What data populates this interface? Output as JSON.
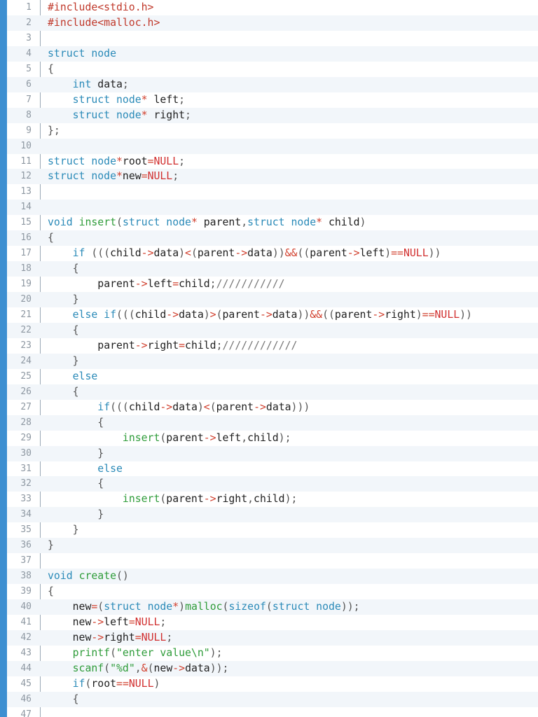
{
  "colors": {
    "accent_bar": "#3d8fd1",
    "keyword": "#2a8ab8",
    "function": "#2f9c3a",
    "operator": "#d1402e",
    "null": "#d12f2f",
    "preprocessor": "#c0392b",
    "string": "#2f9c3a",
    "identifier": "#1f1f1f",
    "line_number": "#8e98a2",
    "alt_row_bg": "#f2f6fa"
  },
  "lines": [
    {
      "n": "1",
      "tokens": [
        {
          "t": "#include<stdio.h>",
          "c": "pp"
        }
      ]
    },
    {
      "n": "2",
      "tokens": [
        {
          "t": "#include<malloc.h>",
          "c": "pp"
        }
      ]
    },
    {
      "n": "3",
      "tokens": []
    },
    {
      "n": "4",
      "tokens": [
        {
          "t": "struct node",
          "c": "kw"
        }
      ]
    },
    {
      "n": "5",
      "tokens": [
        {
          "t": "{",
          "c": "pu"
        }
      ]
    },
    {
      "n": "6",
      "tokens": [
        {
          "t": "    ",
          "c": "id"
        },
        {
          "t": "int",
          "c": "kw"
        },
        {
          "t": " data",
          "c": "id"
        },
        {
          "t": ";",
          "c": "pu"
        }
      ]
    },
    {
      "n": "7",
      "tokens": [
        {
          "t": "    ",
          "c": "id"
        },
        {
          "t": "struct node",
          "c": "kw"
        },
        {
          "t": "*",
          "c": "op"
        },
        {
          "t": " left",
          "c": "id"
        },
        {
          "t": ";",
          "c": "pu"
        }
      ]
    },
    {
      "n": "8",
      "tokens": [
        {
          "t": "    ",
          "c": "id"
        },
        {
          "t": "struct node",
          "c": "kw"
        },
        {
          "t": "*",
          "c": "op"
        },
        {
          "t": " right",
          "c": "id"
        },
        {
          "t": ";",
          "c": "pu"
        }
      ]
    },
    {
      "n": "9",
      "tokens": [
        {
          "t": "};",
          "c": "pu"
        }
      ]
    },
    {
      "n": "10",
      "tokens": []
    },
    {
      "n": "11",
      "tokens": [
        {
          "t": "struct node",
          "c": "kw"
        },
        {
          "t": "*",
          "c": "op"
        },
        {
          "t": "root",
          "c": "id"
        },
        {
          "t": "=",
          "c": "op"
        },
        {
          "t": "NULL",
          "c": "nu"
        },
        {
          "t": ";",
          "c": "pu"
        }
      ]
    },
    {
      "n": "12",
      "tokens": [
        {
          "t": "struct node",
          "c": "kw"
        },
        {
          "t": "*",
          "c": "op"
        },
        {
          "t": "new",
          "c": "id"
        },
        {
          "t": "=",
          "c": "op"
        },
        {
          "t": "NULL",
          "c": "nu"
        },
        {
          "t": ";",
          "c": "pu"
        }
      ]
    },
    {
      "n": "13",
      "tokens": []
    },
    {
      "n": "14",
      "tokens": []
    },
    {
      "n": "15",
      "tokens": [
        {
          "t": "void",
          "c": "kw"
        },
        {
          "t": " ",
          "c": "id"
        },
        {
          "t": "insert",
          "c": "fn"
        },
        {
          "t": "(",
          "c": "pu"
        },
        {
          "t": "struct node",
          "c": "kw"
        },
        {
          "t": "*",
          "c": "op"
        },
        {
          "t": " parent",
          "c": "id"
        },
        {
          "t": ",",
          "c": "pu"
        },
        {
          "t": "struct node",
          "c": "kw"
        },
        {
          "t": "*",
          "c": "op"
        },
        {
          "t": " child",
          "c": "id"
        },
        {
          "t": ")",
          "c": "pu"
        }
      ]
    },
    {
      "n": "16",
      "tokens": [
        {
          "t": "{",
          "c": "pu"
        }
      ]
    },
    {
      "n": "17",
      "tokens": [
        {
          "t": "    ",
          "c": "id"
        },
        {
          "t": "if",
          "c": "kw"
        },
        {
          "t": " (((",
          "c": "pu"
        },
        {
          "t": "child",
          "c": "id"
        },
        {
          "t": "->",
          "c": "op"
        },
        {
          "t": "data",
          "c": "id"
        },
        {
          "t": ")",
          "c": "pu"
        },
        {
          "t": "<",
          "c": "op"
        },
        {
          "t": "(",
          "c": "pu"
        },
        {
          "t": "parent",
          "c": "id"
        },
        {
          "t": "->",
          "c": "op"
        },
        {
          "t": "data",
          "c": "id"
        },
        {
          "t": "))",
          "c": "pu"
        },
        {
          "t": "&&",
          "c": "op"
        },
        {
          "t": "((",
          "c": "pu"
        },
        {
          "t": "parent",
          "c": "id"
        },
        {
          "t": "->",
          "c": "op"
        },
        {
          "t": "left",
          "c": "id"
        },
        {
          "t": ")",
          "c": "pu"
        },
        {
          "t": "==",
          "c": "op"
        },
        {
          "t": "NULL",
          "c": "nu"
        },
        {
          "t": "))",
          "c": "pu"
        }
      ]
    },
    {
      "n": "18",
      "tokens": [
        {
          "t": "    {",
          "c": "pu"
        }
      ]
    },
    {
      "n": "19",
      "tokens": [
        {
          "t": "        ",
          "c": "id"
        },
        {
          "t": "parent",
          "c": "id"
        },
        {
          "t": "->",
          "c": "op"
        },
        {
          "t": "left",
          "c": "id"
        },
        {
          "t": "=",
          "c": "op"
        },
        {
          "t": "child",
          "c": "id"
        },
        {
          "t": ";",
          "c": "pu"
        },
        {
          "t": "///////////",
          "c": "cm"
        }
      ]
    },
    {
      "n": "20",
      "tokens": [
        {
          "t": "    }",
          "c": "pu"
        }
      ]
    },
    {
      "n": "21",
      "tokens": [
        {
          "t": "    ",
          "c": "id"
        },
        {
          "t": "else if",
          "c": "kw"
        },
        {
          "t": "(((",
          "c": "pu"
        },
        {
          "t": "child",
          "c": "id"
        },
        {
          "t": "->",
          "c": "op"
        },
        {
          "t": "data",
          "c": "id"
        },
        {
          "t": ")",
          "c": "pu"
        },
        {
          "t": ">",
          "c": "op"
        },
        {
          "t": "(",
          "c": "pu"
        },
        {
          "t": "parent",
          "c": "id"
        },
        {
          "t": "->",
          "c": "op"
        },
        {
          "t": "data",
          "c": "id"
        },
        {
          "t": "))",
          "c": "pu"
        },
        {
          "t": "&&",
          "c": "op"
        },
        {
          "t": "((",
          "c": "pu"
        },
        {
          "t": "parent",
          "c": "id"
        },
        {
          "t": "->",
          "c": "op"
        },
        {
          "t": "right",
          "c": "id"
        },
        {
          "t": ")",
          "c": "pu"
        },
        {
          "t": "==",
          "c": "op"
        },
        {
          "t": "NULL",
          "c": "nu"
        },
        {
          "t": "))",
          "c": "pu"
        }
      ]
    },
    {
      "n": "22",
      "tokens": [
        {
          "t": "    {",
          "c": "pu"
        }
      ]
    },
    {
      "n": "23",
      "tokens": [
        {
          "t": "        ",
          "c": "id"
        },
        {
          "t": "parent",
          "c": "id"
        },
        {
          "t": "->",
          "c": "op"
        },
        {
          "t": "right",
          "c": "id"
        },
        {
          "t": "=",
          "c": "op"
        },
        {
          "t": "child",
          "c": "id"
        },
        {
          "t": ";",
          "c": "pu"
        },
        {
          "t": "////////////",
          "c": "cm"
        }
      ]
    },
    {
      "n": "24",
      "tokens": [
        {
          "t": "    }",
          "c": "pu"
        }
      ]
    },
    {
      "n": "25",
      "tokens": [
        {
          "t": "    ",
          "c": "id"
        },
        {
          "t": "else",
          "c": "kw"
        }
      ]
    },
    {
      "n": "26",
      "tokens": [
        {
          "t": "    {",
          "c": "pu"
        }
      ]
    },
    {
      "n": "27",
      "tokens": [
        {
          "t": "        ",
          "c": "id"
        },
        {
          "t": "if",
          "c": "kw"
        },
        {
          "t": "(((",
          "c": "pu"
        },
        {
          "t": "child",
          "c": "id"
        },
        {
          "t": "->",
          "c": "op"
        },
        {
          "t": "data",
          "c": "id"
        },
        {
          "t": ")",
          "c": "pu"
        },
        {
          "t": "<",
          "c": "op"
        },
        {
          "t": "(",
          "c": "pu"
        },
        {
          "t": "parent",
          "c": "id"
        },
        {
          "t": "->",
          "c": "op"
        },
        {
          "t": "data",
          "c": "id"
        },
        {
          "t": ")))",
          "c": "pu"
        }
      ]
    },
    {
      "n": "28",
      "tokens": [
        {
          "t": "        {",
          "c": "pu"
        }
      ]
    },
    {
      "n": "29",
      "tokens": [
        {
          "t": "            ",
          "c": "id"
        },
        {
          "t": "insert",
          "c": "fn"
        },
        {
          "t": "(",
          "c": "pu"
        },
        {
          "t": "parent",
          "c": "id"
        },
        {
          "t": "->",
          "c": "op"
        },
        {
          "t": "left",
          "c": "id"
        },
        {
          "t": ",",
          "c": "pu"
        },
        {
          "t": "child",
          "c": "id"
        },
        {
          "t": ");",
          "c": "pu"
        }
      ]
    },
    {
      "n": "30",
      "tokens": [
        {
          "t": "        }",
          "c": "pu"
        }
      ]
    },
    {
      "n": "31",
      "tokens": [
        {
          "t": "        ",
          "c": "id"
        },
        {
          "t": "else",
          "c": "kw"
        }
      ]
    },
    {
      "n": "32",
      "tokens": [
        {
          "t": "        {",
          "c": "pu"
        }
      ]
    },
    {
      "n": "33",
      "tokens": [
        {
          "t": "            ",
          "c": "id"
        },
        {
          "t": "insert",
          "c": "fn"
        },
        {
          "t": "(",
          "c": "pu"
        },
        {
          "t": "parent",
          "c": "id"
        },
        {
          "t": "->",
          "c": "op"
        },
        {
          "t": "right",
          "c": "id"
        },
        {
          "t": ",",
          "c": "pu"
        },
        {
          "t": "child",
          "c": "id"
        },
        {
          "t": ");",
          "c": "pu"
        }
      ]
    },
    {
      "n": "34",
      "tokens": [
        {
          "t": "        }",
          "c": "pu"
        }
      ]
    },
    {
      "n": "35",
      "tokens": [
        {
          "t": "    }",
          "c": "pu"
        }
      ]
    },
    {
      "n": "36",
      "tokens": [
        {
          "t": "}",
          "c": "pu"
        }
      ]
    },
    {
      "n": "37",
      "tokens": []
    },
    {
      "n": "38",
      "tokens": [
        {
          "t": "void",
          "c": "kw"
        },
        {
          "t": " ",
          "c": "id"
        },
        {
          "t": "create",
          "c": "fn"
        },
        {
          "t": "()",
          "c": "pu"
        }
      ]
    },
    {
      "n": "39",
      "tokens": [
        {
          "t": "{",
          "c": "pu"
        }
      ]
    },
    {
      "n": "40",
      "tokens": [
        {
          "t": "    ",
          "c": "id"
        },
        {
          "t": "new",
          "c": "id"
        },
        {
          "t": "=",
          "c": "op"
        },
        {
          "t": "(",
          "c": "pu"
        },
        {
          "t": "struct node",
          "c": "kw"
        },
        {
          "t": "*",
          "c": "op"
        },
        {
          "t": ")",
          "c": "pu"
        },
        {
          "t": "malloc",
          "c": "fn"
        },
        {
          "t": "(",
          "c": "pu"
        },
        {
          "t": "sizeof",
          "c": "kw"
        },
        {
          "t": "(",
          "c": "pu"
        },
        {
          "t": "struct node",
          "c": "kw"
        },
        {
          "t": "));",
          "c": "pu"
        }
      ]
    },
    {
      "n": "41",
      "tokens": [
        {
          "t": "    ",
          "c": "id"
        },
        {
          "t": "new",
          "c": "id"
        },
        {
          "t": "->",
          "c": "op"
        },
        {
          "t": "left",
          "c": "id"
        },
        {
          "t": "=",
          "c": "op"
        },
        {
          "t": "NULL",
          "c": "nu"
        },
        {
          "t": ";",
          "c": "pu"
        }
      ]
    },
    {
      "n": "42",
      "tokens": [
        {
          "t": "    ",
          "c": "id"
        },
        {
          "t": "new",
          "c": "id"
        },
        {
          "t": "->",
          "c": "op"
        },
        {
          "t": "right",
          "c": "id"
        },
        {
          "t": "=",
          "c": "op"
        },
        {
          "t": "NULL",
          "c": "nu"
        },
        {
          "t": ";",
          "c": "pu"
        }
      ]
    },
    {
      "n": "43",
      "tokens": [
        {
          "t": "    ",
          "c": "id"
        },
        {
          "t": "printf",
          "c": "fn"
        },
        {
          "t": "(",
          "c": "pu"
        },
        {
          "t": "\"enter value\\n\"",
          "c": "st"
        },
        {
          "t": ");",
          "c": "pu"
        }
      ]
    },
    {
      "n": "44",
      "tokens": [
        {
          "t": "    ",
          "c": "id"
        },
        {
          "t": "scanf",
          "c": "fn"
        },
        {
          "t": "(",
          "c": "pu"
        },
        {
          "t": "\"%d\"",
          "c": "st"
        },
        {
          "t": ",",
          "c": "pu"
        },
        {
          "t": "&",
          "c": "op"
        },
        {
          "t": "(",
          "c": "pu"
        },
        {
          "t": "new",
          "c": "id"
        },
        {
          "t": "->",
          "c": "op"
        },
        {
          "t": "data",
          "c": "id"
        },
        {
          "t": "));",
          "c": "pu"
        }
      ]
    },
    {
      "n": "45",
      "tokens": [
        {
          "t": "    ",
          "c": "id"
        },
        {
          "t": "if",
          "c": "kw"
        },
        {
          "t": "(",
          "c": "pu"
        },
        {
          "t": "root",
          "c": "id"
        },
        {
          "t": "==",
          "c": "op"
        },
        {
          "t": "NULL",
          "c": "nu"
        },
        {
          "t": ")",
          "c": "pu"
        }
      ]
    },
    {
      "n": "46",
      "tokens": [
        {
          "t": "    {",
          "c": "pu"
        }
      ]
    },
    {
      "n": "47",
      "tokens": []
    }
  ]
}
